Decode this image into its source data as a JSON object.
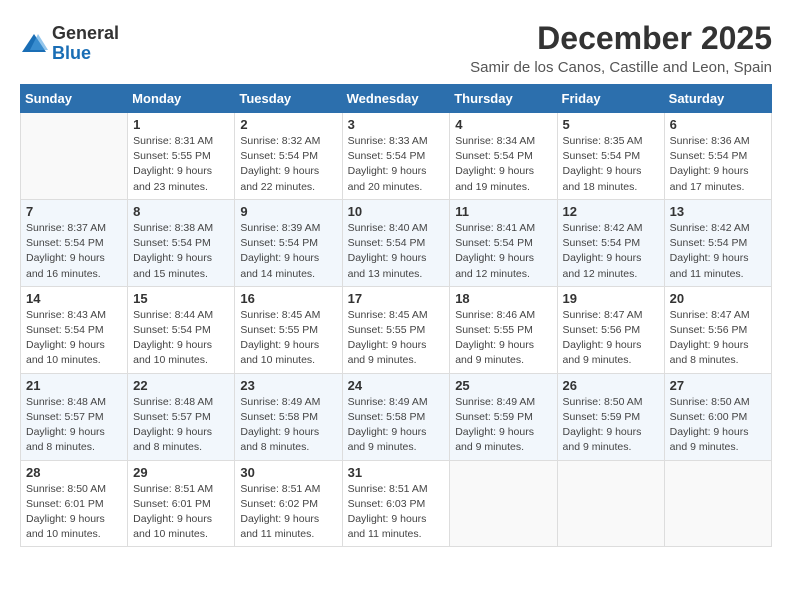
{
  "logo": {
    "general": "General",
    "blue": "Blue"
  },
  "title": "December 2025",
  "subtitle": "Samir de los Canos, Castille and Leon, Spain",
  "days_of_week": [
    "Sunday",
    "Monday",
    "Tuesday",
    "Wednesday",
    "Thursday",
    "Friday",
    "Saturday"
  ],
  "weeks": [
    [
      {
        "day": "",
        "info": ""
      },
      {
        "day": "1",
        "info": "Sunrise: 8:31 AM\nSunset: 5:55 PM\nDaylight: 9 hours\nand 23 minutes."
      },
      {
        "day": "2",
        "info": "Sunrise: 8:32 AM\nSunset: 5:54 PM\nDaylight: 9 hours\nand 22 minutes."
      },
      {
        "day": "3",
        "info": "Sunrise: 8:33 AM\nSunset: 5:54 PM\nDaylight: 9 hours\nand 20 minutes."
      },
      {
        "day": "4",
        "info": "Sunrise: 8:34 AM\nSunset: 5:54 PM\nDaylight: 9 hours\nand 19 minutes."
      },
      {
        "day": "5",
        "info": "Sunrise: 8:35 AM\nSunset: 5:54 PM\nDaylight: 9 hours\nand 18 minutes."
      },
      {
        "day": "6",
        "info": "Sunrise: 8:36 AM\nSunset: 5:54 PM\nDaylight: 9 hours\nand 17 minutes."
      }
    ],
    [
      {
        "day": "7",
        "info": "Sunrise: 8:37 AM\nSunset: 5:54 PM\nDaylight: 9 hours\nand 16 minutes."
      },
      {
        "day": "8",
        "info": "Sunrise: 8:38 AM\nSunset: 5:54 PM\nDaylight: 9 hours\nand 15 minutes."
      },
      {
        "day": "9",
        "info": "Sunrise: 8:39 AM\nSunset: 5:54 PM\nDaylight: 9 hours\nand 14 minutes."
      },
      {
        "day": "10",
        "info": "Sunrise: 8:40 AM\nSunset: 5:54 PM\nDaylight: 9 hours\nand 13 minutes."
      },
      {
        "day": "11",
        "info": "Sunrise: 8:41 AM\nSunset: 5:54 PM\nDaylight: 9 hours\nand 12 minutes."
      },
      {
        "day": "12",
        "info": "Sunrise: 8:42 AM\nSunset: 5:54 PM\nDaylight: 9 hours\nand 12 minutes."
      },
      {
        "day": "13",
        "info": "Sunrise: 8:42 AM\nSunset: 5:54 PM\nDaylight: 9 hours\nand 11 minutes."
      }
    ],
    [
      {
        "day": "14",
        "info": "Sunrise: 8:43 AM\nSunset: 5:54 PM\nDaylight: 9 hours\nand 10 minutes."
      },
      {
        "day": "15",
        "info": "Sunrise: 8:44 AM\nSunset: 5:54 PM\nDaylight: 9 hours\nand 10 minutes."
      },
      {
        "day": "16",
        "info": "Sunrise: 8:45 AM\nSunset: 5:55 PM\nDaylight: 9 hours\nand 10 minutes."
      },
      {
        "day": "17",
        "info": "Sunrise: 8:45 AM\nSunset: 5:55 PM\nDaylight: 9 hours\nand 9 minutes."
      },
      {
        "day": "18",
        "info": "Sunrise: 8:46 AM\nSunset: 5:55 PM\nDaylight: 9 hours\nand 9 minutes."
      },
      {
        "day": "19",
        "info": "Sunrise: 8:47 AM\nSunset: 5:56 PM\nDaylight: 9 hours\nand 9 minutes."
      },
      {
        "day": "20",
        "info": "Sunrise: 8:47 AM\nSunset: 5:56 PM\nDaylight: 9 hours\nand 8 minutes."
      }
    ],
    [
      {
        "day": "21",
        "info": "Sunrise: 8:48 AM\nSunset: 5:57 PM\nDaylight: 9 hours\nand 8 minutes."
      },
      {
        "day": "22",
        "info": "Sunrise: 8:48 AM\nSunset: 5:57 PM\nDaylight: 9 hours\nand 8 minutes."
      },
      {
        "day": "23",
        "info": "Sunrise: 8:49 AM\nSunset: 5:58 PM\nDaylight: 9 hours\nand 8 minutes."
      },
      {
        "day": "24",
        "info": "Sunrise: 8:49 AM\nSunset: 5:58 PM\nDaylight: 9 hours\nand 9 minutes."
      },
      {
        "day": "25",
        "info": "Sunrise: 8:49 AM\nSunset: 5:59 PM\nDaylight: 9 hours\nand 9 minutes."
      },
      {
        "day": "26",
        "info": "Sunrise: 8:50 AM\nSunset: 5:59 PM\nDaylight: 9 hours\nand 9 minutes."
      },
      {
        "day": "27",
        "info": "Sunrise: 8:50 AM\nSunset: 6:00 PM\nDaylight: 9 hours\nand 9 minutes."
      }
    ],
    [
      {
        "day": "28",
        "info": "Sunrise: 8:50 AM\nSunset: 6:01 PM\nDaylight: 9 hours\nand 10 minutes."
      },
      {
        "day": "29",
        "info": "Sunrise: 8:51 AM\nSunset: 6:01 PM\nDaylight: 9 hours\nand 10 minutes."
      },
      {
        "day": "30",
        "info": "Sunrise: 8:51 AM\nSunset: 6:02 PM\nDaylight: 9 hours\nand 11 minutes."
      },
      {
        "day": "31",
        "info": "Sunrise: 8:51 AM\nSunset: 6:03 PM\nDaylight: 9 hours\nand 11 minutes."
      },
      {
        "day": "",
        "info": ""
      },
      {
        "day": "",
        "info": ""
      },
      {
        "day": "",
        "info": ""
      }
    ]
  ]
}
